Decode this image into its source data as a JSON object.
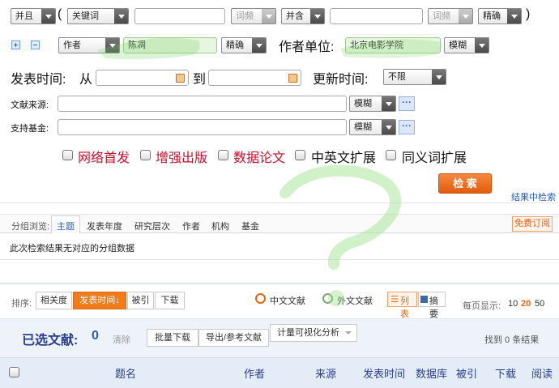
{
  "row1": {
    "logic1": "并且",
    "open_paren": "(",
    "field1": "关键词",
    "match1": "词频",
    "logic2": "并含",
    "match2": "词频",
    "precision": "精确",
    "close_paren": ")"
  },
  "row2": {
    "author_field": "作者",
    "author_value": "陈凋",
    "author_precision": "精确",
    "unit_label": "作者单位:",
    "unit_value": "北京电影学院",
    "unit_precision": "模糊"
  },
  "row3": {
    "publish_label": "发表时间:",
    "from_label": "从",
    "to_label": "到",
    "update_label": "更新时间:",
    "update_value": "不限"
  },
  "row4": {
    "source_label": "文献来源:",
    "source_precision": "模糊"
  },
  "row5": {
    "fund_label": "支持基金:",
    "fund_precision": "模糊"
  },
  "options": {
    "o1": "网络首发",
    "o2": "增强出版",
    "o3": "数据论文",
    "o4": "中英文扩展",
    "o5": "同义词扩展"
  },
  "search_button": "检 索",
  "search_in_results": "结果中检索",
  "group": {
    "label": "分组浏览:",
    "tabs": [
      "主题",
      "发表年度",
      "研究层次",
      "作者",
      "机构",
      "基金"
    ],
    "subscribe": "免费订阅",
    "message": "此次检索结果无对应的分组数据"
  },
  "sort": {
    "label": "排序:",
    "relevance": "相关度",
    "publish_time": "发表时间",
    "cited": "被引",
    "download": "下载",
    "chinese": "中文文献",
    "foreign": "外文文献",
    "list": "列表",
    "summary": "摘要",
    "per_page_label": "每页显示:",
    "per_page": [
      "10",
      "20",
      "50"
    ]
  },
  "selected": {
    "label": "已选文献:",
    "count": "0",
    "clear": "清除",
    "batch_download": "批量下载",
    "export": "导出/参考文献",
    "visualize": "计量可视化分析",
    "found": "找到 0 条结果"
  },
  "columns": [
    "题名",
    "作者",
    "来源",
    "发表时间",
    "数据库",
    "被引",
    "下载",
    "阅读"
  ],
  "colors": {
    "red_option": "#c8102e",
    "search_btn": "#e9661a",
    "blue_text": "#2a3e8c",
    "highlight_tab": "#f07b1a"
  }
}
